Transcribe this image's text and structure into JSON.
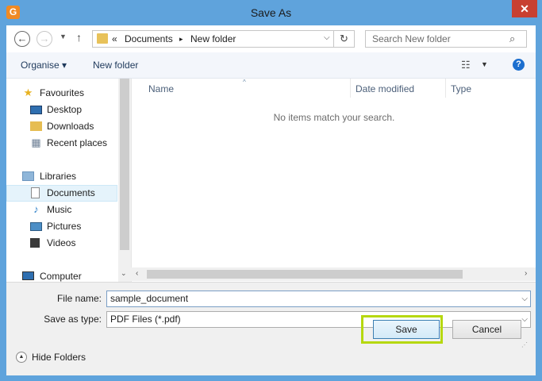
{
  "window": {
    "title": "Save As",
    "app_icon_letter": "G",
    "close_glyph": "✕"
  },
  "nav": {
    "address": {
      "prefix": "«",
      "segments": [
        "Documents",
        "New folder"
      ],
      "separator": "▸"
    },
    "search_placeholder": "Search New folder"
  },
  "toolbar": {
    "organise": "Organise ▾",
    "new_folder": "New folder",
    "help": "?"
  },
  "sidebar": {
    "items": [
      {
        "label": "Favourites",
        "icon": "star-icon"
      },
      {
        "label": "Desktop",
        "icon": "desktop-icon"
      },
      {
        "label": "Downloads",
        "icon": "downloads-icon"
      },
      {
        "label": "Recent places",
        "icon": "recent-places-icon"
      },
      {
        "label": "Libraries",
        "icon": "libraries-icon"
      },
      {
        "label": "Documents",
        "icon": "documents-icon",
        "selected": true
      },
      {
        "label": "Music",
        "icon": "music-icon"
      },
      {
        "label": "Pictures",
        "icon": "pictures-icon"
      },
      {
        "label": "Videos",
        "icon": "videos-icon"
      },
      {
        "label": "Computer",
        "icon": "computer-icon"
      }
    ]
  },
  "files": {
    "columns": [
      "Name",
      "Date modified",
      "Type"
    ],
    "empty_message": "No items match your search."
  },
  "form": {
    "file_name_label": "File name:",
    "file_name_value": "sample_document",
    "save_type_label": "Save as type:",
    "save_type_value": "PDF Files (*.pdf)"
  },
  "footer": {
    "hide_folders": "Hide Folders",
    "save": "Save",
    "cancel": "Cancel"
  },
  "colors": {
    "highlight": "#b6d80f",
    "title_bar": "#5fa3dc",
    "close": "#c84031"
  }
}
